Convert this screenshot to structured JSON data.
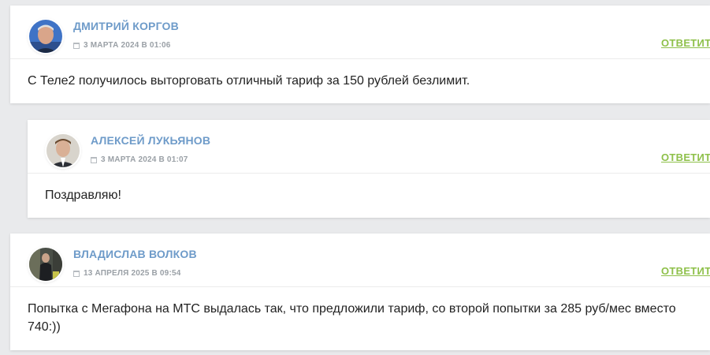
{
  "comments": [
    {
      "author": "ДМИТРИЙ КОРГОВ",
      "date": "3 МАРТА 2024 В 01:06",
      "text": "С Теле2 получилось выторговать отличный тариф за 150 рублей безлимит.",
      "reply_label": "ОТВЕТИТЬ"
    },
    {
      "author": "АЛЕКСЕЙ ЛУКЬЯНОВ",
      "date": "3 МАРТА 2024 В 01:07",
      "text": "Поздравляю!",
      "reply_label": "ОТВЕТИТЬ"
    },
    {
      "author": "ВЛАДИСЛАВ ВОЛКОВ",
      "date": "13 АПРЕЛЯ 2025 В 09:54",
      "text": "Попытка с Мегафона на МТС выдалась так, что предложили тариф, со второй попытки за 285 руб/мес вместо 740:))",
      "reply_label": "ОТВЕТИТЬ"
    }
  ],
  "colors": {
    "author": "#6e9bc9",
    "reply": "#8ec04a",
    "date": "#9aa0a6",
    "text": "#222222",
    "background": "#e9eaec"
  },
  "icons": {
    "date": "calendar-icon"
  }
}
